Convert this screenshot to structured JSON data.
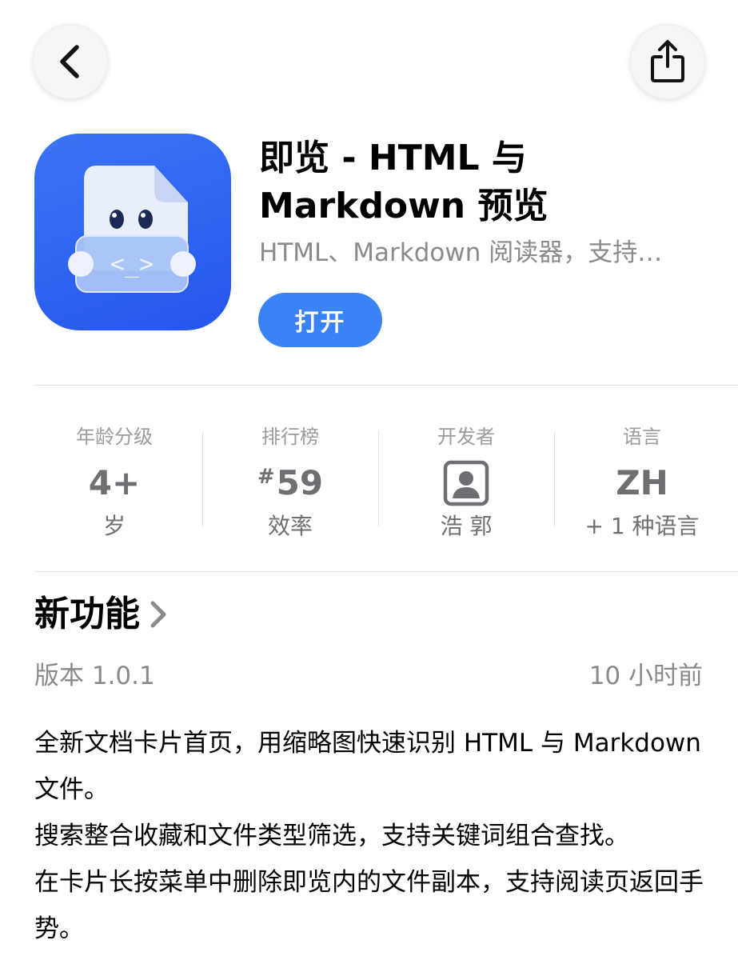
{
  "nav": {
    "back_icon": "chevron-left-icon",
    "share_icon": "share-icon"
  },
  "app": {
    "name": "即览 - HTML 与\nMarkdown 预览",
    "subtitle": "HTML、Markdown 阅读器，支持…",
    "open_label": "打开",
    "icon_code": "<_>",
    "brand_color": "#2f66f0",
    "button_color": "#3a82f6"
  },
  "info": [
    {
      "label": "年龄分级",
      "value": "4+",
      "sub": "岁"
    },
    {
      "label": "排行榜",
      "hash": "#",
      "value": "59",
      "sub": "效率"
    },
    {
      "label": "开发者",
      "icon": "person-square-icon",
      "sub": "浩 郭"
    },
    {
      "label": "语言",
      "value": "ZH",
      "sub": "+ 1 种语言"
    }
  ],
  "whats_new": {
    "title": "新功能",
    "version": "版本 1.0.1",
    "time_ago": "10 小时前",
    "notes": [
      "全新文档卡片首页，用缩略图快速识别 HTML 与 Markdown 文件。",
      "搜索整合收藏和文件类型筛选，支持关键词组合查找。",
      "在卡片长按菜单中删除即览内的文件副本，支持阅读页返回手势。"
    ]
  }
}
